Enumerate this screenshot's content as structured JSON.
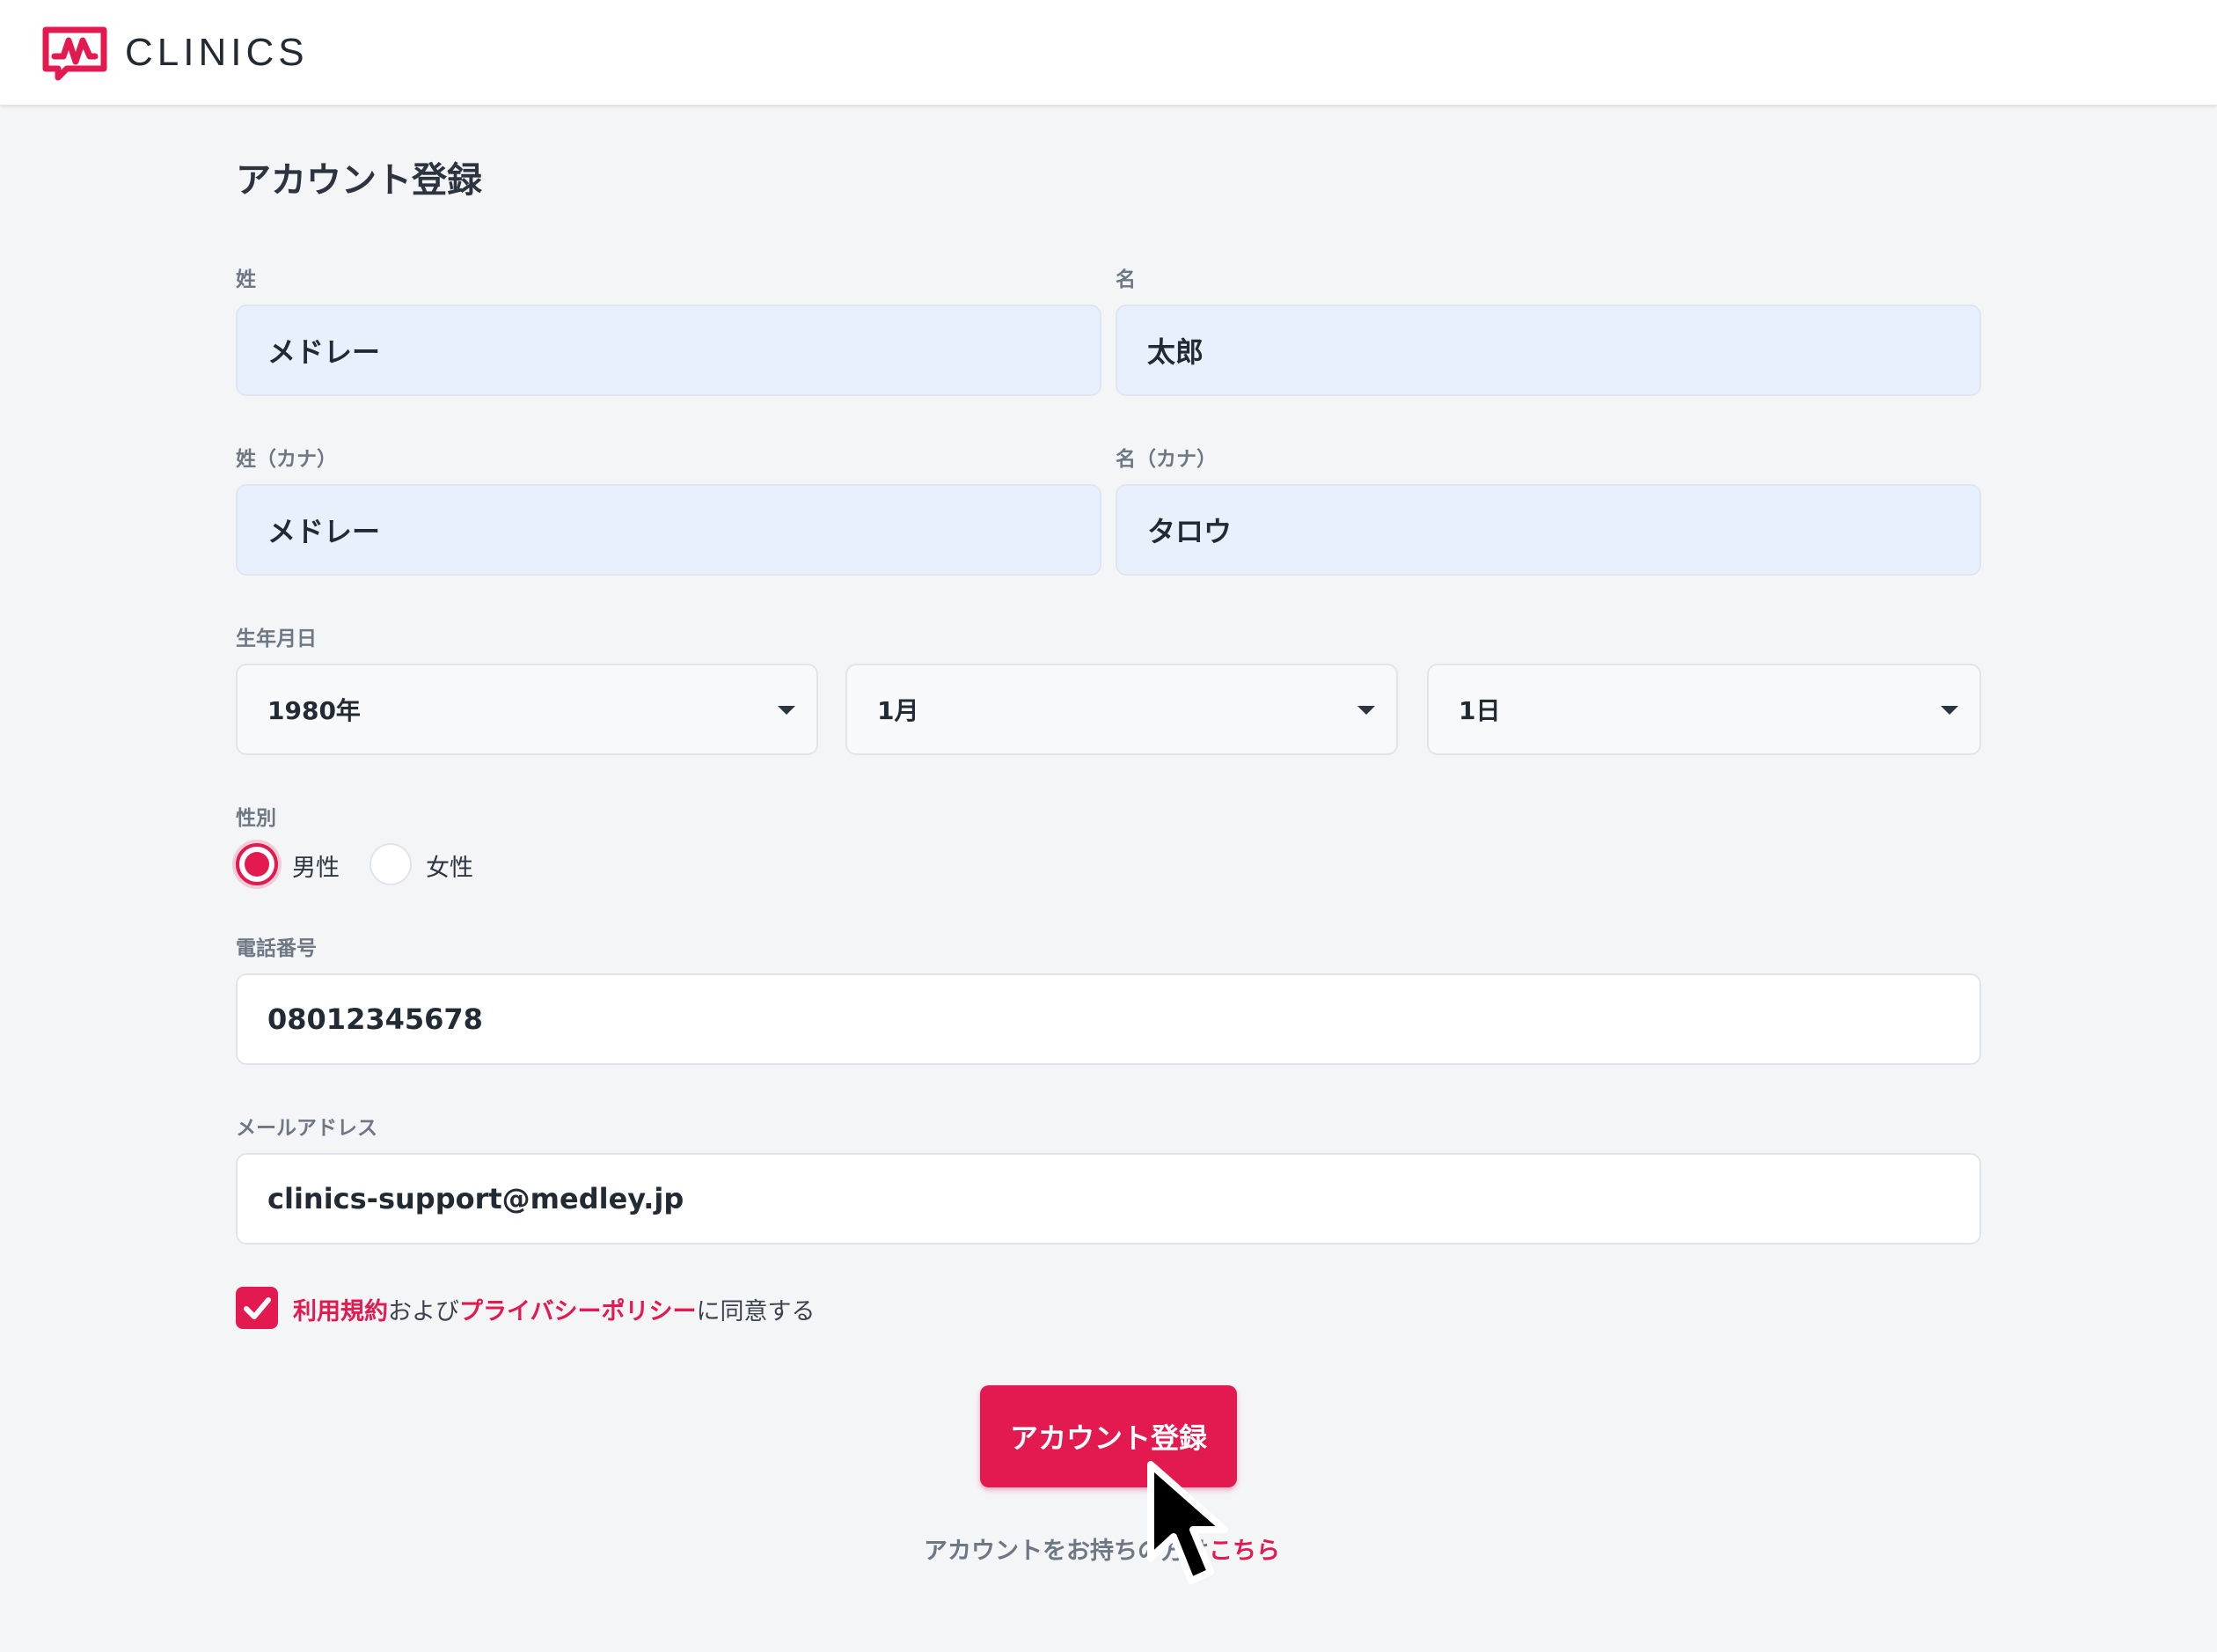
{
  "header": {
    "logo_text": "CLINICS"
  },
  "page": {
    "title": "アカウント登録"
  },
  "form": {
    "last_name": {
      "label": "姓",
      "value": "メドレー"
    },
    "first_name": {
      "label": "名",
      "value": "太郎"
    },
    "last_name_kana": {
      "label": "姓（カナ）",
      "value": "メドレー"
    },
    "first_name_kana": {
      "label": "名（カナ）",
      "value": "タロウ"
    },
    "birthdate": {
      "label": "生年月日",
      "year": "1980年",
      "month": "1月",
      "day": "1日"
    },
    "gender": {
      "label": "性別",
      "options": [
        {
          "label": "男性",
          "selected": true
        },
        {
          "label": "女性",
          "selected": false
        }
      ]
    },
    "phone": {
      "label": "電話番号",
      "value": "08012345678"
    },
    "email": {
      "label": "メールアドレス",
      "value": "clinics-support@medley.jp"
    },
    "agreement": {
      "checked": true,
      "terms_link": "利用規約",
      "and_text": "および",
      "privacy_link": "プライバシーポリシー",
      "suffix_text": "に同意する"
    },
    "submit_label": "アカウント登録"
  },
  "login": {
    "prompt": "アカウントをお持ちの方は",
    "link": "こちら"
  },
  "colors": {
    "accent": "#e31a4f",
    "autofill": "#e8f0fe",
    "background": "#f4f5f7"
  }
}
